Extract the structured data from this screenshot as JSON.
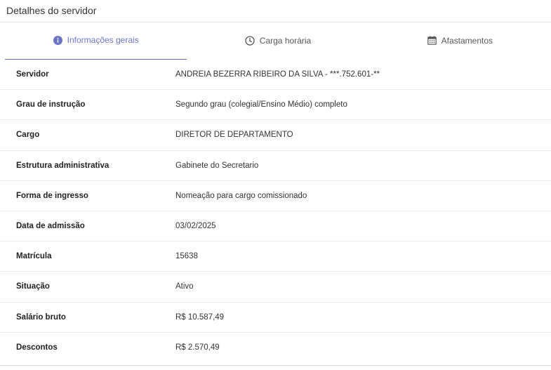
{
  "header": {
    "title": "Detalhes do servidor"
  },
  "tabs": [
    {
      "label": "Informações gerais",
      "icon": "info-icon",
      "active": true
    },
    {
      "label": "Carga horária",
      "icon": "clock-icon",
      "active": false
    },
    {
      "label": "Afastamentos",
      "icon": "calendar-icon",
      "active": false
    }
  ],
  "colors": {
    "accent": "#6b73c9"
  },
  "details": [
    {
      "label": "Servidor",
      "value": "ANDREIA BEZERRA RIBEIRO DA SILVA - ***.752.601-**"
    },
    {
      "label": "Grau de instrução",
      "value": "Segundo grau (colegial/Ensino Médio) completo"
    },
    {
      "label": "Cargo",
      "value": "DIRETOR DE DEPARTAMENTO"
    },
    {
      "label": "Estrutura administrativa",
      "value": "Gabinete do Secretario"
    },
    {
      "label": "Forma de ingresso",
      "value": "Nomeação para cargo comissionado"
    },
    {
      "label": "Data de admissão",
      "value": "03/02/2025"
    },
    {
      "label": "Matrícula",
      "value": "15638"
    },
    {
      "label": "Situação",
      "value": "Ativo"
    },
    {
      "label": "Salário bruto",
      "value": "R$ 10.587,49"
    },
    {
      "label": "Descontos",
      "value": "R$ 2.570,49"
    }
  ]
}
